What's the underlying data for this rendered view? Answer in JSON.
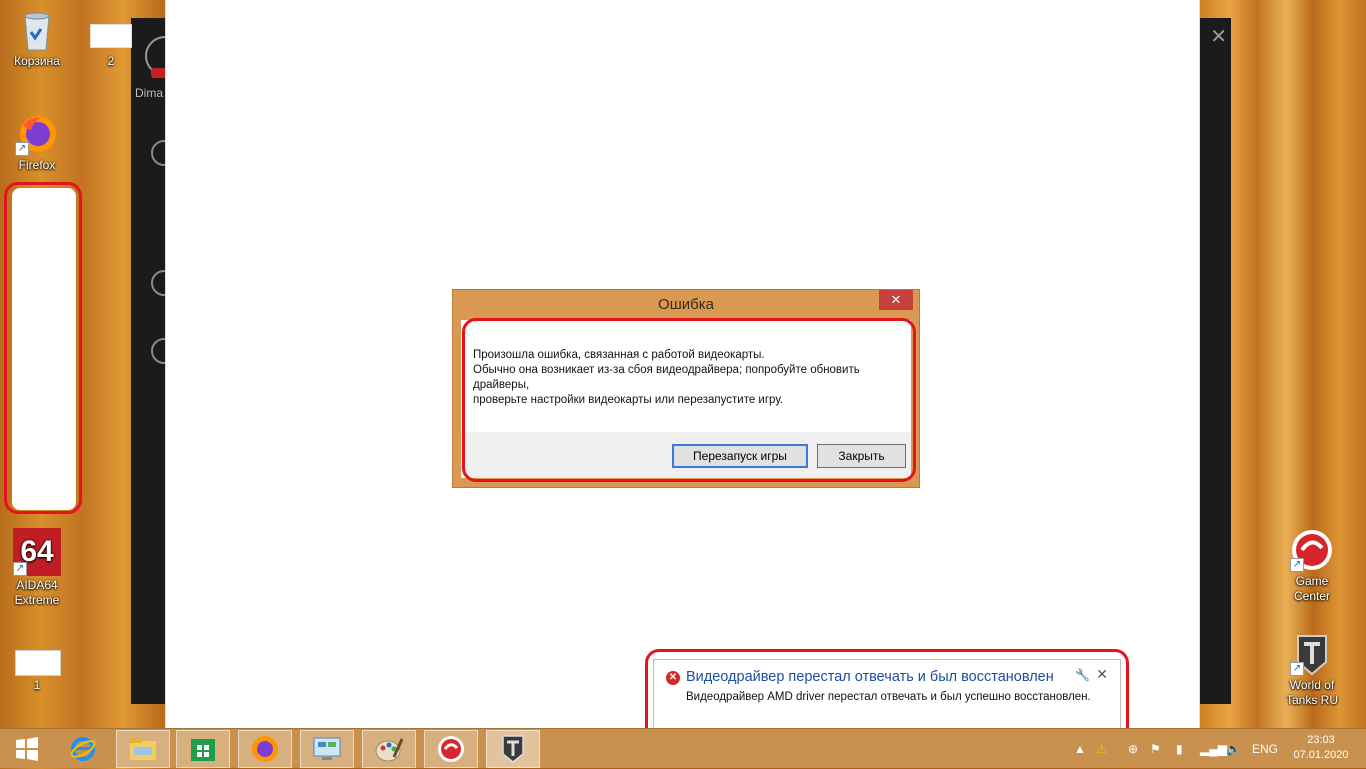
{
  "desktop": {
    "recycle_bin": "Корзина",
    "file2": "2",
    "firefox": "Firefox",
    "aida64_line1": "AIDA64",
    "aida64_line2": "Extreme",
    "file1": "1",
    "game_center": "Game Center",
    "wot_line1": "World of",
    "wot_line2": "Tanks RU"
  },
  "launcher": {
    "username": "Dima"
  },
  "dialog": {
    "title": "Ошибка",
    "message_lines": [
      "Произошла ошибка, связанная с работой видеокарты.",
      "Обычно она возникает из-за сбоя видеодрайвера; попробуйте обновить",
      "драйверы,",
      "проверьте настройки видеокарты или перезапустите игру."
    ],
    "restart_button": "Перезапуск игры",
    "close_button": "Закрыть"
  },
  "notification": {
    "title": "Видеодрайвер перестал отвечать и был восстановлен",
    "text": "Видеодрайвер AMD driver перестал отвечать и был успешно восстановлен."
  },
  "taskbar": {
    "language": "ENG",
    "time": "23:03",
    "date": "07.01.2020",
    "apps": [
      "start-icon",
      "ie-icon",
      "explorer-icon",
      "store-icon",
      "firefox-icon",
      "control-panel-icon",
      "paint-icon",
      "game-center-icon",
      "world-of-tanks-icon"
    ]
  },
  "colors": {
    "highlight_ring": "#e3141c",
    "dialog_frame": "#d99952",
    "notification_title": "#1b4fa0",
    "taskbar": "#c8924e"
  }
}
